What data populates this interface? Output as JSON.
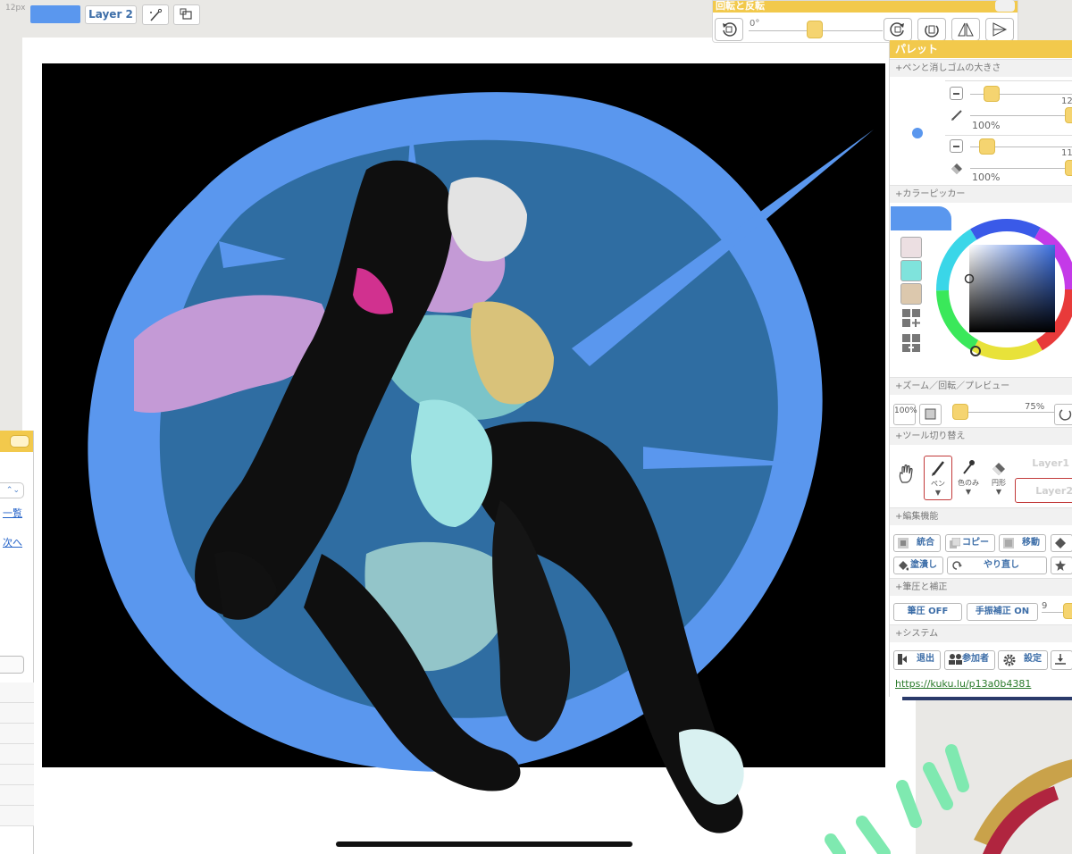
{
  "toolbar": {
    "brush_size_label": "12px",
    "current_color": "#5a97ee",
    "layer_button_label": "Layer 2",
    "tool_icons": [
      "magic-wand-icon",
      "transform-icon"
    ]
  },
  "rotate_panel": {
    "title": "回転と反転",
    "angle": "0°",
    "buttons": [
      "rotate-left-icon",
      "rotate-right-icon",
      "reset-rotation-icon",
      "flip-horizontal-icon",
      "flip-vertical-icon"
    ]
  },
  "left_panel": {
    "link_list": "一覧",
    "link_next": "次へ"
  },
  "palette": {
    "title": "パレット",
    "sections": {
      "pen_size": "+ペンと消しゴムの大きさ",
      "color_picker": "+カラーピッカー",
      "zoom": "+ズーム／回転／プレビュー",
      "tool_switch": "+ツール切り替え",
      "edit": "+編集機能",
      "pressure": "+筆圧と補正",
      "system": "+システム"
    },
    "pen": {
      "size": "12",
      "opacity": "100%"
    },
    "eraser": {
      "size": "11",
      "opacity": "100%"
    },
    "swatches": [
      "#ecdfe2",
      "#7fe3dc",
      "#dcc8ad"
    ],
    "zoom": {
      "btn_100": "100%",
      "percent": "75%"
    },
    "tools": {
      "pen": "ペン",
      "color_only": "色のみ",
      "circle": "円形",
      "layer1": "Layer1",
      "layer2": "Layer2"
    },
    "edit": {
      "merge": "統合",
      "copy": "コピー",
      "move": "移動",
      "fill": "塗潰し",
      "redo": "やり直し"
    },
    "pressure": {
      "pressure_btn": "筆圧 OFF",
      "stabilizer_btn": "手振補正 ON",
      "stabilizer_value": "9"
    },
    "system": {
      "exit": "退出",
      "participants": "参加者",
      "settings": "設定"
    },
    "room_url": "https://kuku.lu/p13a0b4381"
  },
  "colors": {
    "accent_yellow": "#f2c94c",
    "brush_blue": "#5a97ee",
    "circle_dark": "#2d6aa0"
  }
}
